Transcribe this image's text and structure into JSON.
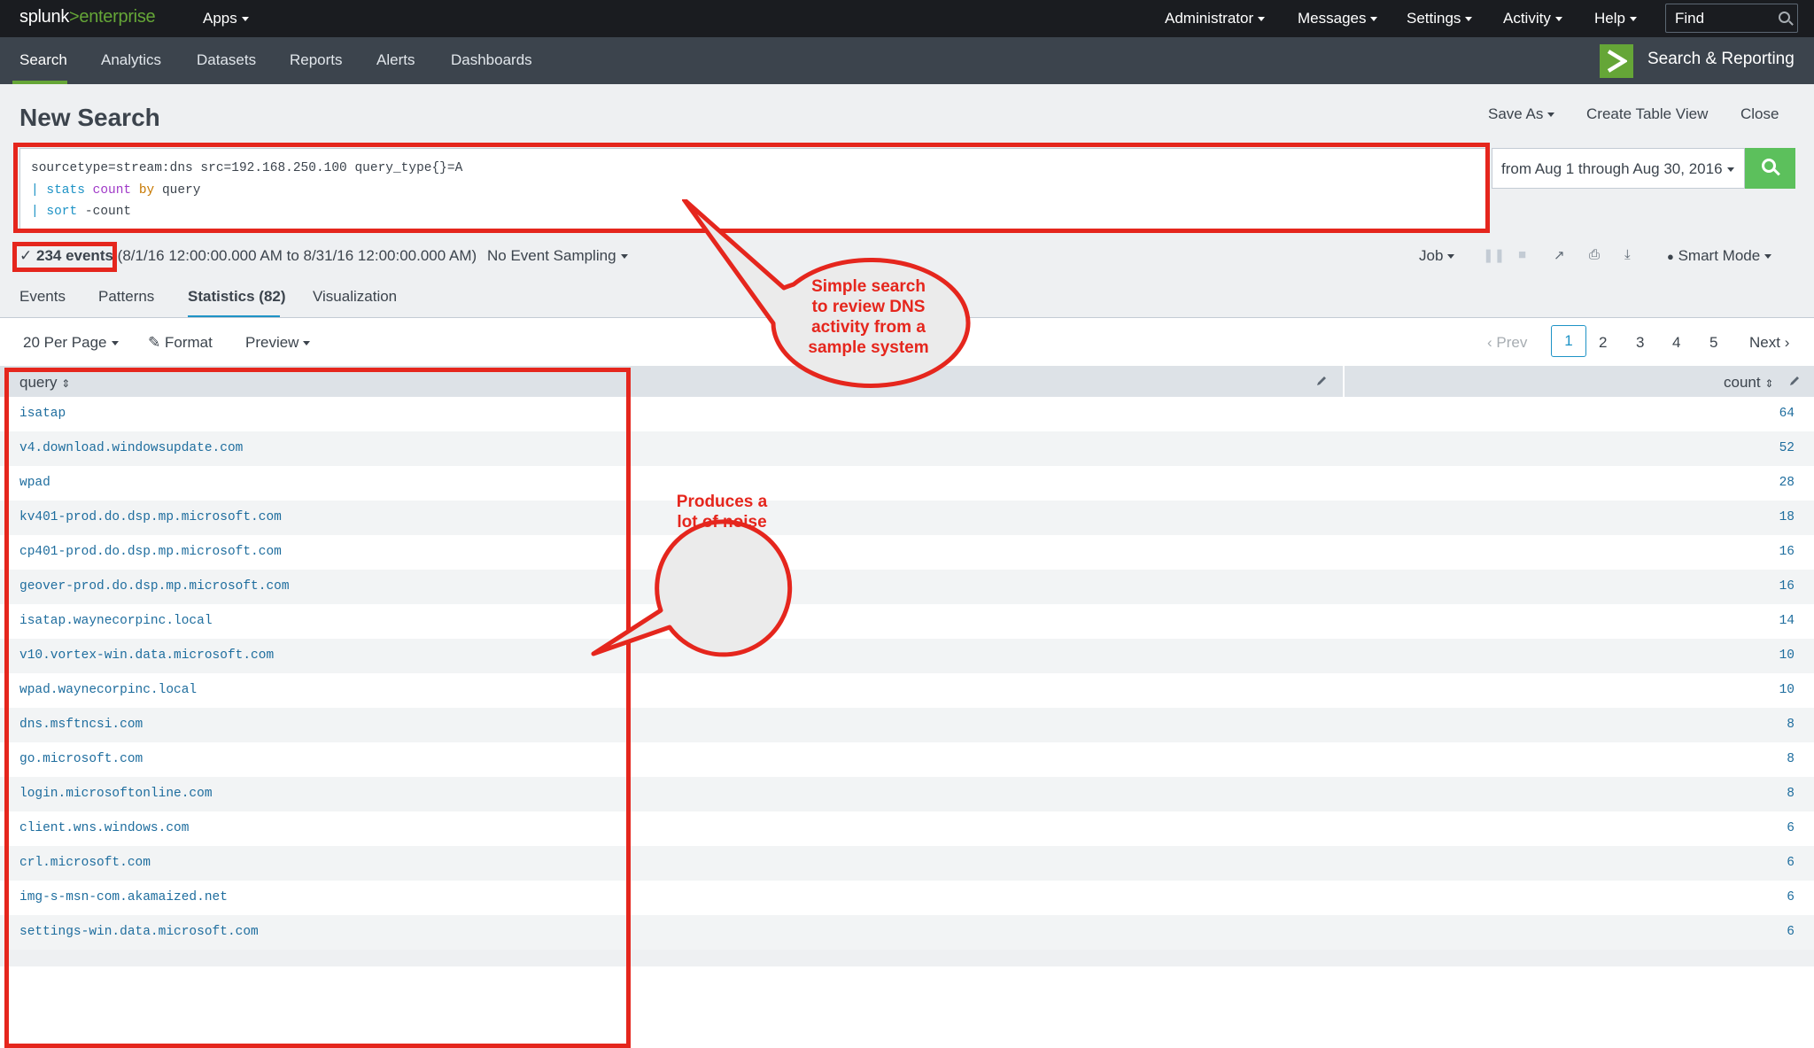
{
  "topbar": {
    "logo_main": "splunk",
    "logo_sep": ">",
    "logo_product": "enterprise",
    "apps": "Apps",
    "menus": [
      "Administrator",
      "Messages",
      "Settings",
      "Activity",
      "Help"
    ],
    "find_placeholder": "Find"
  },
  "appbar": {
    "nav": [
      "Search",
      "Analytics",
      "Datasets",
      "Reports",
      "Alerts",
      "Dashboards"
    ],
    "active": "Search",
    "app_name": "Search & Reporting"
  },
  "header": {
    "title": "New Search",
    "save_as": "Save As",
    "create_table_view": "Create Table View",
    "close": "Close"
  },
  "search": {
    "line1": "sourcetype=stream:dns src=192.168.250.100 query_type{}=A",
    "line2_pipe": "| ",
    "line2_cmd": "stats",
    "line2_fn": "count",
    "line2_by": "by",
    "line2_field": "query",
    "line3_pipe": "| ",
    "line3_cmd": "sort",
    "line3_arg": "-count",
    "time_range": "from Aug 1 through Aug 30, 2016"
  },
  "status": {
    "check": "✓",
    "events": "234 events",
    "range": "(8/1/16 12:00:00.000 AM to 8/31/16 12:00:00.000 AM)",
    "sampling": "No Event Sampling",
    "job": "Job",
    "mode": "Smart Mode"
  },
  "tabs": [
    "Events",
    "Patterns",
    "Statistics (82)",
    "Visualization"
  ],
  "toolbar": {
    "per_page": "20 Per Page",
    "format": "Format",
    "preview": "Preview",
    "prev": "Prev",
    "pages": [
      "1",
      "2",
      "3",
      "4",
      "5"
    ],
    "current_page": "1",
    "next": "Next"
  },
  "table": {
    "columns": [
      "query",
      "count"
    ],
    "rows": [
      {
        "query": "isatap",
        "count": "64"
      },
      {
        "query": "v4.download.windowsupdate.com",
        "count": "52"
      },
      {
        "query": "wpad",
        "count": "28"
      },
      {
        "query": "kv401-prod.do.dsp.mp.microsoft.com",
        "count": "18"
      },
      {
        "query": "cp401-prod.do.dsp.mp.microsoft.com",
        "count": "16"
      },
      {
        "query": "geover-prod.do.dsp.mp.microsoft.com",
        "count": "16"
      },
      {
        "query": "isatap.waynecorpinc.local",
        "count": "14"
      },
      {
        "query": "v10.vortex-win.data.microsoft.com",
        "count": "10"
      },
      {
        "query": "wpad.waynecorpinc.local",
        "count": "10"
      },
      {
        "query": "dns.msftncsi.com",
        "count": "8"
      },
      {
        "query": "go.microsoft.com",
        "count": "8"
      },
      {
        "query": "login.microsoftonline.com",
        "count": "8"
      },
      {
        "query": "client.wns.windows.com",
        "count": "6"
      },
      {
        "query": "crl.microsoft.com",
        "count": "6"
      },
      {
        "query": "img-s-msn-com.akamaized.net",
        "count": "6"
      },
      {
        "query": "settings-win.data.microsoft.com",
        "count": "6"
      }
    ]
  },
  "annotations": {
    "callout1": [
      "Simple search",
      "to review DNS",
      "activity from a",
      "sample system"
    ],
    "callout2": [
      "Produces a",
      "lot of noise"
    ],
    "color": "#e5261d"
  }
}
